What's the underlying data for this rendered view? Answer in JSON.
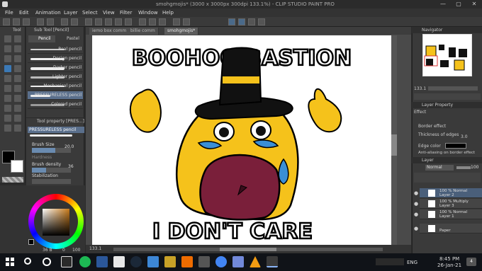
{
  "window": {
    "title": "smohgmojis* (3000 x 3000px 300dpi 133.1%) - CLIP STUDIO PAINT PRO",
    "min_glyph": "—",
    "max_glyph": "▢",
    "close_glyph": "✕"
  },
  "menu": [
    "File",
    "Edit",
    "Animation",
    "Layer",
    "Select",
    "View",
    "Filter",
    "Window",
    "Help"
  ],
  "left": {
    "tab_tool": "Tool",
    "tab_subtool": "Sub Tool [Pencil]",
    "subtool_tabs": [
      "Pencil",
      "Pastel"
    ],
    "brushes": [
      "Real pencil",
      "Design pencil",
      "Darker pencil",
      "Lighter pencil",
      "Mechanical pencil",
      "PRESSURELESS pencil",
      "Colored pencil"
    ],
    "tool_property_title": "Tool property [PRES...]",
    "tool_property_name": "PRESSURELESS pencil",
    "brush_size_label": "Brush Size",
    "brush_size_value": "20.0",
    "hardness_label": "Hardness",
    "brush_density_label": "Brush density",
    "brush_density_value": "36",
    "stabilization_label": "Stabilization",
    "color_status_left": "36 B",
    "color_status_right": "0",
    "color_status_far": "100"
  },
  "canvas_tabs": [
    "iemo box comm",
    "billie comm",
    "smohgmojis*"
  ],
  "canvas_status": {
    "zoom": "133.1"
  },
  "drawing": {
    "top_text": "BOOHOO BASTION",
    "bottom_text": "I DON'T CARE"
  },
  "right": {
    "navigator": "Navigator",
    "nav_zoom": "133.1",
    "layer_property": "Layer Property",
    "effect": "Effect",
    "border_effect_label": "Border effect",
    "thickness_label": "Thickness of edges",
    "thickness_value": "3.0",
    "edge_color_label": "Edge color",
    "antialias_label": "Anti-aliasing on border effect",
    "layer_panel": "Layer",
    "blend_mode": "Normal",
    "opacity": "100",
    "layers": [
      {
        "line1": "100 % Normal",
        "line2": "Layer 2"
      },
      {
        "line1": "100 % Multiply",
        "line2": "Layer 3"
      },
      {
        "line1": "100 % Normal",
        "line2": "Layer 1"
      },
      {
        "line1": "",
        "line2": "Paper"
      }
    ]
  },
  "taskbar": {
    "language": "ENG",
    "time": "8:45 PM",
    "date": "26-Jan-21",
    "notifications": "4"
  },
  "colors": {
    "accent": "#3b79b6",
    "mascot_yellow": "#f5c21b",
    "mouth_maroon": "#7a1f3a",
    "tear_blue": "#3a8fd6"
  }
}
